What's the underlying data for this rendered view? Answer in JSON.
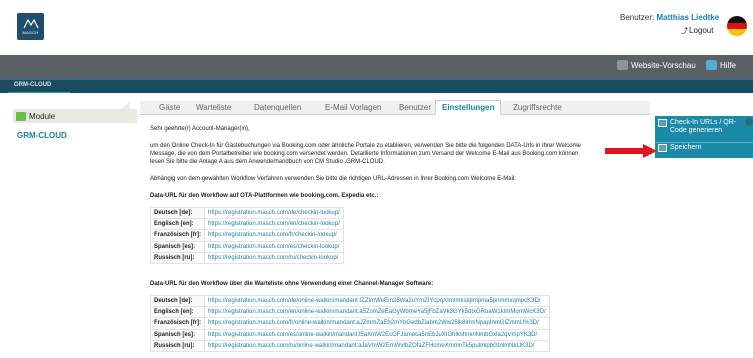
{
  "header": {
    "logo_text": "MASCH",
    "user_label": "Benutzer:",
    "user_name": "Matthias Liedtke",
    "logout_label": "Logout"
  },
  "topbar": {
    "preview_label": "Website-Vorschau",
    "help_label": "Hilfe"
  },
  "breadcrumb": "GRM-CLOUD",
  "sidebar": {
    "header": "Module",
    "item": "GRM-CLOUD"
  },
  "tabs": [
    {
      "label": "Gäste"
    },
    {
      "label": "Warteliste"
    },
    {
      "label": "Datenquellen"
    },
    {
      "label": "E-Mail Vorlagen"
    },
    {
      "label": "Benutzer"
    },
    {
      "label": "Einstellungen"
    },
    {
      "label": "Zugriffsrechte"
    }
  ],
  "active_tab": "Einstellungen",
  "content": {
    "greeting": "Sehr geehrte(r) Account-Manager(in),",
    "intro_1": "um den Online Check-In für Gästebuchungen via Booking.com oder ähnliche Portale zu etablieren, verwenden Sie bitte die folgenden DATA-Urls in Ihrer Welcome",
    "intro_2": "Message, die von dem Portalbetreiber wie booking.com versendet werden. Detaillierte Informationen zum Versand der Welcome E-Mail aus Booking.com können",
    "intro_3": "lesen Sie bitte die Anlage A aus dem Anwenderhandbuch von CM Studio .GRM-CLOUD.",
    "workflow_note": "Abhängig von dem gewählten Workflow Verfahren verwenden Sie bitte die richtigen URL-Adressen in Ihrer Booking.com Welcome E-Mail:",
    "section1_title": "Data-URL für den Workflow auf OTA-Plattformen wie booking.com, Expedia etc.:",
    "section1_rows": [
      {
        "lang": "Deutsch [de]:",
        "url": "https://registration.masch.com/de/checkin-lookup/"
      },
      {
        "lang": "Englisch [en]:",
        "url": "https://registration.masch.com/en/checkin-lookup/"
      },
      {
        "lang": "Französisch [fr]:",
        "url": "https://registration.masch.com/fr/checkin-lookup/"
      },
      {
        "lang": "Spanisch [es]:",
        "url": "https://registration.masch.com/es/checkin-lookup/"
      },
      {
        "lang": "Russisch [ru]:",
        "url": "https://registration.masch.com/ru/checkin-lookup/"
      }
    ],
    "section2_title": "Data-URL für den Workflow über die Warteliste ohne Verwendung einer Channel-Manager Software:",
    "section2_rows": [
      {
        "lang": "Deutsch [de]:",
        "url": "https://registration.masch.com/de/online-walkin/mandant:IZZImWeEm25Wa2uYmZIYcpqXImtmkslqImpma5pnmmxqmpcK3D/"
      },
      {
        "lang": "Englisch [en]:",
        "url": "https://registration.masch.com/en/online-walkin/mandant:a5ZsmZeEaGyWbmeYa5jFbZaVk3GYk5dtxGRoaW1kImMomWcK3D/"
      },
      {
        "lang": "Französisch [fr]:",
        "url": "https://registration.masch.com/fr/online-walkin/mandant:aJZmmZaEb2mYbGedbZiabm2Ww25lk8lrImNpapInmGIZmmU%3D/"
      },
      {
        "lang": "Spanisch [es]:",
        "url": "https://registration.masch.com/es/online-walkin/mandant:l5aXmW2EcGFJameca5nEbJuXIGhlkshnknNmbGxla2qVmpYK3D/"
      },
      {
        "lang": "Russisch [ru]:",
        "url": "https://registration.masch.com/ru/online-walkin/mandant:aJaVmW2EmWvIbZOfaZFHcmeXmmnTk5pulmlpbGtnlmNkLlK3D/"
      }
    ]
  },
  "rpanel": {
    "check_in_label": "Check-In URLs / QR-Code generieren",
    "save_label": "Speichern"
  },
  "colors": {
    "accent": "#1d7fa6",
    "dark_bar": "#5b6065",
    "teal_bar": "#1a4c60",
    "panel": "#1a8aa6",
    "arrow": "#e0141e"
  }
}
